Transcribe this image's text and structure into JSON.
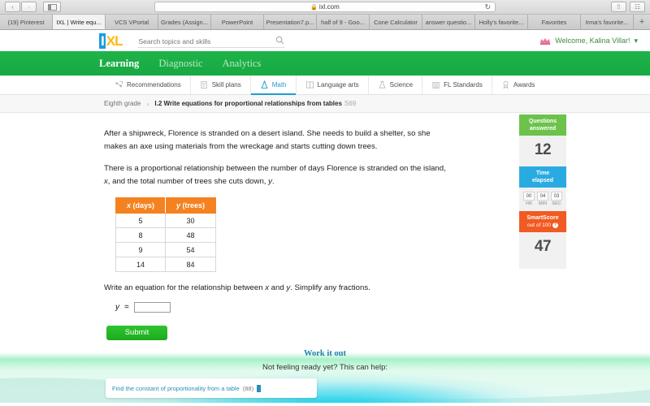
{
  "browser": {
    "url": "ixl.com",
    "lock_icon": "lock-icon",
    "back_label": "‹",
    "forward_label": "›",
    "sidebar_icon": "sidebar-icon",
    "reload_label": "↻",
    "share_icon": "share-icon",
    "tabs_icon": "show-tabs-icon",
    "new_tab_label": "+",
    "tabs": [
      {
        "title": "(19) Pinterest",
        "active": false
      },
      {
        "title": "IXL | Write equ...",
        "active": true
      },
      {
        "title": "VCS VPortal",
        "active": false
      },
      {
        "title": "Grades (Assign...",
        "active": false
      },
      {
        "title": "PowerPoint",
        "active": false
      },
      {
        "title": "Presentation7.p...",
        "active": false
      },
      {
        "title": "half of 9 - Goo...",
        "active": false
      },
      {
        "title": "Cone Calculator",
        "active": false
      },
      {
        "title": "answer questio...",
        "active": false
      },
      {
        "title": "Holly's favorite...",
        "active": false
      },
      {
        "title": "Favorites",
        "active": false
      },
      {
        "title": "Irma's favorite...",
        "active": false
      }
    ]
  },
  "header": {
    "logo_i": "I",
    "logo_xl": "XL",
    "search_placeholder": "Search topics and skills",
    "search_value": "",
    "search_icon": "search-icon",
    "crown_icon": "crown-icon",
    "welcome_text": "Welcome, Kalina Villar!",
    "welcome_caret": "▾"
  },
  "green_nav": [
    {
      "label": "Learning",
      "active": true
    },
    {
      "label": "Diagnostic",
      "active": false
    },
    {
      "label": "Analytics",
      "active": false
    }
  ],
  "subnav": [
    {
      "label": "Recommendations",
      "icon": "recommendations-icon",
      "active": false
    },
    {
      "label": "Skill plans",
      "icon": "skill-plans-icon",
      "active": false
    },
    {
      "label": "Math",
      "icon": "math-compass-icon",
      "active": true
    },
    {
      "label": "Language arts",
      "icon": "book-icon",
      "active": false
    },
    {
      "label": "Science",
      "icon": "flask-icon",
      "active": false
    },
    {
      "label": "FL Standards",
      "icon": "building-icon",
      "active": false
    },
    {
      "label": "Awards",
      "icon": "award-ribbon-icon",
      "active": false
    }
  ],
  "breadcrumb": {
    "grade": "Eighth grade",
    "separator": "›",
    "skill": "I.2 Write equations for proportional relationships from tables",
    "code": "S69"
  },
  "question": {
    "paragraph1": "After a shipwreck, Florence is stranded on a desert island. She needs to build a shelter, so she makes an axe using materials from the wreckage and starts cutting down trees.",
    "paragraph2_a": "There is a proportional relationship between the number of days Florence is stranded on the island, ",
    "paragraph2_x": "x",
    "paragraph2_b": ", and the total number of trees she cuts down, ",
    "paragraph2_y": "y",
    "paragraph2_c": ".",
    "prompt_a": "Write an equation for the relationship between ",
    "prompt_x": "x",
    "prompt_and": " and ",
    "prompt_y": "y",
    "prompt_b": ". Simplify any fractions.",
    "answer_label": "y",
    "answer_equals": "=",
    "answer_value": "",
    "submit_label": "Submit"
  },
  "table": {
    "header_x_var": "x",
    "header_x_unit": " (days)",
    "header_y_var": "y",
    "header_y_unit": " (trees)",
    "rows": [
      {
        "x": "5",
        "y": "30"
      },
      {
        "x": "8",
        "y": "48"
      },
      {
        "x": "9",
        "y": "54"
      },
      {
        "x": "14",
        "y": "84"
      }
    ]
  },
  "stats": {
    "questions_title_l1": "Questions",
    "questions_title_l2": "answered",
    "questions_value": "12",
    "time_title_l1": "Time",
    "time_title_l2": "elapsed",
    "time_hr": "00",
    "time_min": "04",
    "time_sec": "03",
    "time_hr_label": "HR",
    "time_min_label": "MIN",
    "time_sec_label": "SEC",
    "smartscore_title": "SmartScore",
    "smartscore_sub": "out of 100",
    "smartscore_help_icon": "help-icon",
    "smartscore_help_glyph": "?",
    "smartscore_value": "47"
  },
  "workout": {
    "title": "Work it out",
    "subtitle": "Not feeling ready yet? This can help:",
    "help_card_text": "Find the constant of proportionality from a table",
    "help_card_count": "(88)",
    "help_card_badge_icon": "video-badge-icon"
  },
  "colors": {
    "ixl_green": "#1fb34a",
    "ixl_blue": "#1b9ce3",
    "ixl_yellow": "#fdb913",
    "table_orange": "#f58220",
    "questions_green": "#6cc24a",
    "time_blue": "#29abe2",
    "smartscore_orange": "#f15a22",
    "submit_green": "#22bb22",
    "workout_title_blue": "#1b7fa8"
  }
}
